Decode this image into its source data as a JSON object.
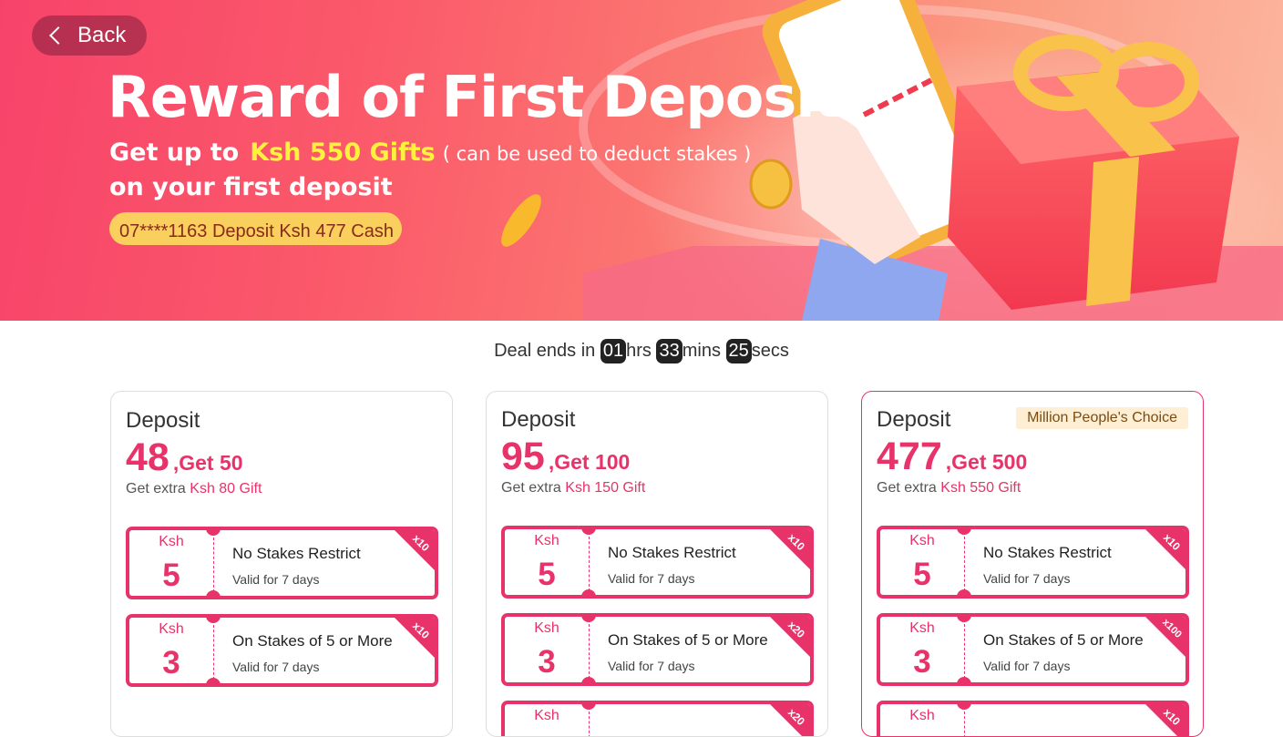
{
  "hero": {
    "back_label": "Back",
    "title": "Reward of First Deposit",
    "subtitle_prefix": "Get up to",
    "subtitle_highlight": "Ksh 550 Gifts",
    "subtitle_note": "( can be used to deduct stakes )",
    "subtitle_line2": "on your first deposit",
    "ticker": "07****1163 Deposit Ksh 477 Cash"
  },
  "timer": {
    "prefix": "Deal ends in",
    "hours": "01",
    "hours_label": "hrs",
    "mins": "33",
    "mins_label": "mins",
    "secs": "25",
    "secs_label": "secs"
  },
  "cards": [
    {
      "deposit_label": "Deposit",
      "amount": "48",
      "get": ",Get 50",
      "extra_prefix": "Get extra",
      "extra_value": "Ksh 80 Gift",
      "coupons": [
        {
          "currency": "Ksh",
          "value": "5",
          "title": "No Stakes Restrict",
          "valid": "Valid for 7 days",
          "multiplier": "x10"
        },
        {
          "currency": "Ksh",
          "value": "3",
          "title": "On Stakes of 5 or More",
          "valid": "Valid for 7 days",
          "multiplier": "x10"
        }
      ]
    },
    {
      "deposit_label": "Deposit",
      "amount": "95",
      "get": ",Get 100",
      "extra_prefix": "Get extra",
      "extra_value": "Ksh 150 Gift",
      "coupons": [
        {
          "currency": "Ksh",
          "value": "5",
          "title": "No Stakes Restrict",
          "valid": "Valid for 7 days",
          "multiplier": "x10"
        },
        {
          "currency": "Ksh",
          "value": "3",
          "title": "On Stakes of 5 or More",
          "valid": "Valid for 7 days",
          "multiplier": "x20"
        },
        {
          "currency": "Ksh",
          "value": "",
          "title": "",
          "valid": "",
          "multiplier": "x20"
        }
      ]
    },
    {
      "deposit_label": "Deposit",
      "badge": "Million People's Choice",
      "amount": "477",
      "get": ",Get 500",
      "extra_prefix": "Get extra",
      "extra_value": "Ksh 550 Gift",
      "coupons": [
        {
          "currency": "Ksh",
          "value": "5",
          "title": "No Stakes Restrict",
          "valid": "Valid for 7 days",
          "multiplier": "x10"
        },
        {
          "currency": "Ksh",
          "value": "3",
          "title": "On Stakes of 5 or More",
          "valid": "Valid for 7 days",
          "multiplier": "x100"
        },
        {
          "currency": "Ksh",
          "value": "",
          "title": "",
          "valid": "",
          "multiplier": "x10"
        }
      ]
    }
  ],
  "colors": {
    "accent": "#e8336a",
    "highlight": "#fdf23c",
    "ticker_bg": "#f9cf5e"
  }
}
